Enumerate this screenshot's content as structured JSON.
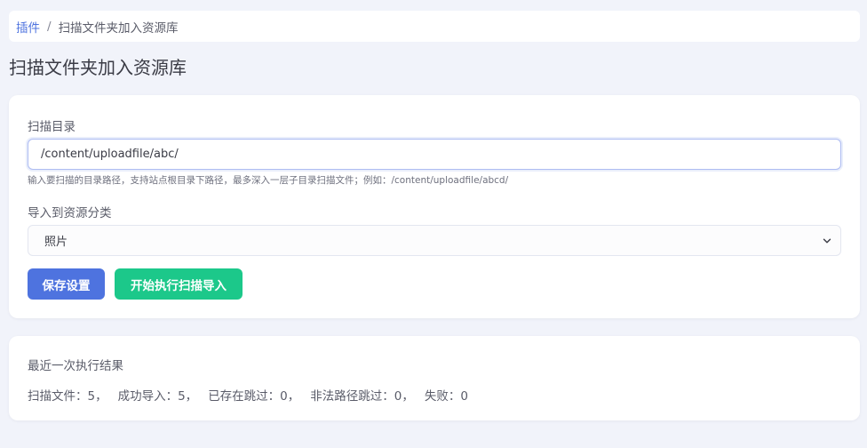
{
  "breadcrumb": {
    "parent": "插件",
    "separator": "/",
    "current": "扫描文件夹加入资源库"
  },
  "page_title": "扫描文件夹加入资源库",
  "settings": {
    "scan_dir_label": "扫描目录",
    "scan_dir_value": "/content/uploadfile/abc/",
    "scan_dir_help": "输入要扫描的目录路径，支持站点根目录下路径，最多深入一层子目录扫描文件；例如：/content/uploadfile/abcd/",
    "category_label": "导入到资源分类",
    "category_selected": "照片",
    "save_button": "保存设置",
    "start_button": "开始执行扫描导入"
  },
  "result": {
    "title": "最近一次执行结果",
    "stats": [
      "扫描文件：5，",
      "成功导入：5，",
      "已存在跳过：0，",
      "非法路径跳过：0，",
      "失败：0"
    ]
  },
  "colors": {
    "primary": "#4e73df",
    "success": "#1cc88a",
    "background": "#f1f3fa"
  },
  "icons": {
    "select_chevron": "chevron-down-icon"
  }
}
